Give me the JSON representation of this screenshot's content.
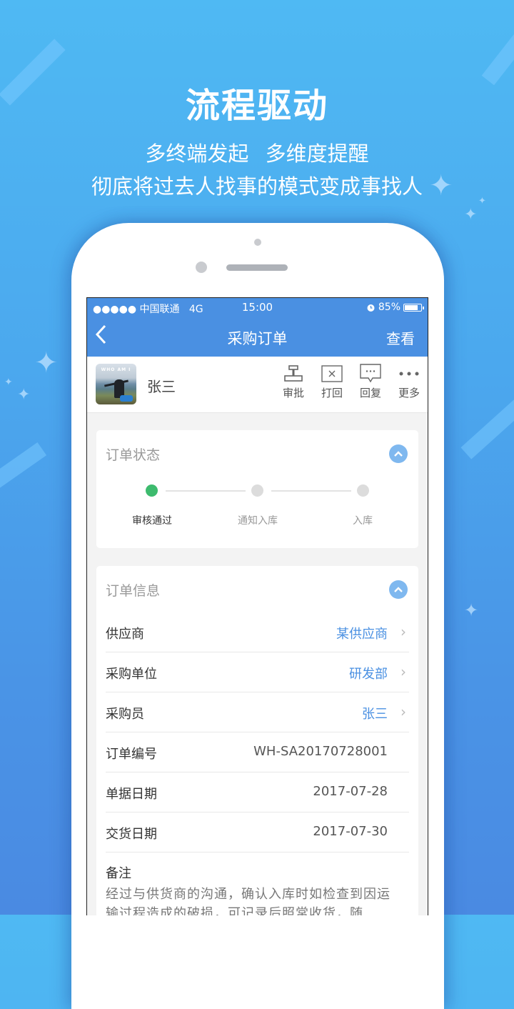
{
  "hero": {
    "title": "流程驱动",
    "subtitle_line1": "多终端发起 多维度提醒",
    "subtitle_line2": "彻底将过去人找事的模式变成事找人"
  },
  "status_bar": {
    "carrier": "●●●●● 中国联通",
    "network": "4G",
    "time": "15:00",
    "alarm_icon": "alarm-clock-icon",
    "battery_percent": "85%",
    "battery_level": 0.85
  },
  "nav": {
    "back_icon": "chevron-left-icon",
    "title": "采购订单",
    "action": "查看"
  },
  "user": {
    "name": "张三",
    "avatar_caption": "WHO AM I"
  },
  "actions": [
    {
      "label": "审批",
      "icon": "stamp-icon"
    },
    {
      "label": "打回",
      "icon": "reject-box-icon"
    },
    {
      "label": "回复",
      "icon": "comment-bubble-icon"
    },
    {
      "label": "更多",
      "icon": "more-dots-icon"
    }
  ],
  "order_status": {
    "title": "订单状态",
    "steps": [
      {
        "label": "审核通过",
        "done": true
      },
      {
        "label": "通知入库",
        "done": false
      },
      {
        "label": "入库",
        "done": false
      }
    ]
  },
  "order_info": {
    "title": "订单信息",
    "rows": [
      {
        "key": "供应商",
        "value": "某供应商",
        "link": true
      },
      {
        "key": "采购单位",
        "value": "研发部",
        "link": true
      },
      {
        "key": "采购员",
        "value": "张三",
        "link": true
      },
      {
        "key": "订单编号",
        "value": "WH-SA20170728001",
        "link": false
      },
      {
        "key": "单据日期",
        "value": "2017-07-28",
        "link": false
      },
      {
        "key": "交货日期",
        "value": "2017-07-30",
        "link": false
      }
    ],
    "remark_title": "备注",
    "remark_text": "经过与供货商的沟通，确认入库时如检查到因运输过程造成的破损，可记录后照常收货，随"
  },
  "colors": {
    "primary": "#4a90e2",
    "step_done": "#3dbb6e",
    "step_pending": "#dcdcdc",
    "collapse_button": "#7fb8ef"
  }
}
